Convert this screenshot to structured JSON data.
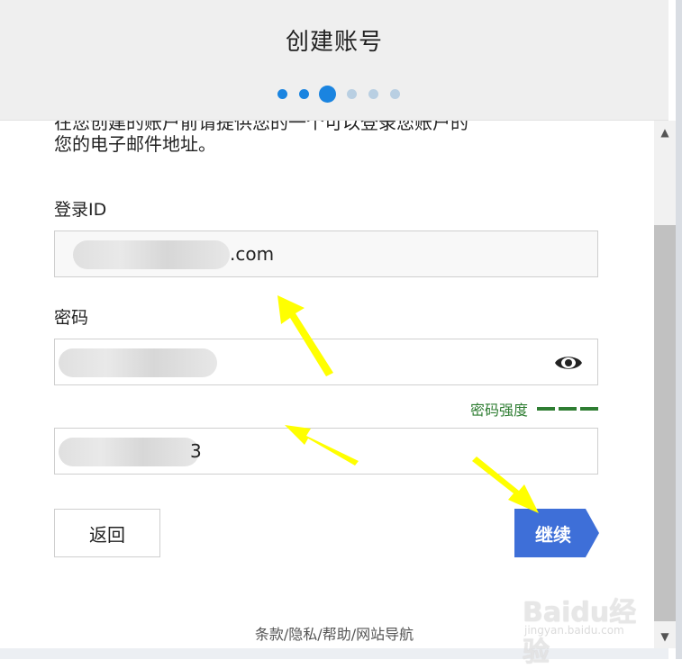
{
  "header": {
    "title": "创建账号",
    "steps": {
      "total": 6,
      "current": 3
    }
  },
  "intro": {
    "partial_line": "在您创建的账户前请提供您的一个可以登录您账户的",
    "text": "您的电子邮件地址。"
  },
  "login": {
    "label": "登录ID",
    "value_suffix": ".com"
  },
  "password": {
    "label": "密码",
    "strength_label": "密码强度",
    "strength_level": 3
  },
  "confirm": {
    "value_suffix": "3"
  },
  "buttons": {
    "back": "返回",
    "next": "继续"
  },
  "footer": {
    "links": [
      "条款",
      "隐私",
      "帮助",
      "网站导航"
    ],
    "separator": "/"
  },
  "watermark": {
    "main": "Baidu经验",
    "sub": "jingyan.baidu.com"
  },
  "colors": {
    "accent": "#1a84e0",
    "button": "#3e6fd8",
    "strength": "#2e7d32",
    "annotation_arrow": "#ffff00"
  }
}
